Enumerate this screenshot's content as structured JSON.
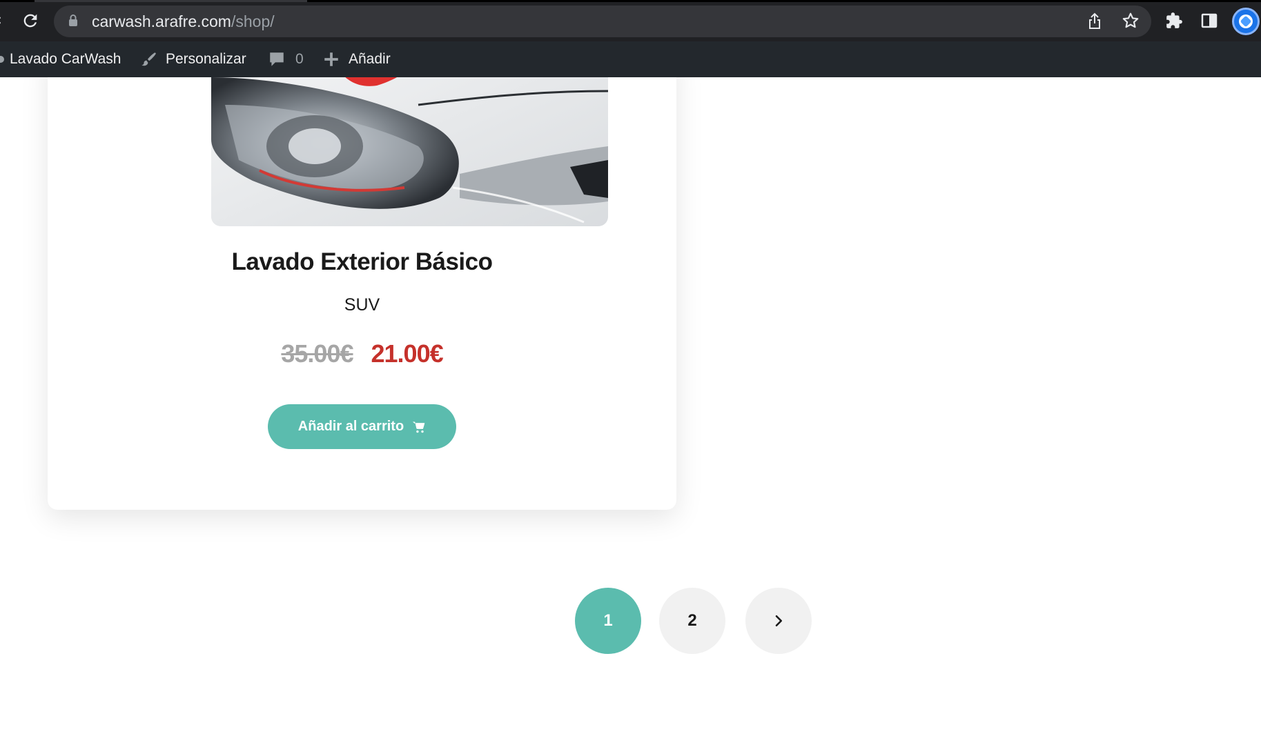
{
  "browser": {
    "url_host": "carwash.arafre.com",
    "url_path": "/shop/"
  },
  "adminbar": {
    "site_name": "Lavado CarWash",
    "customize_label": "Personalizar",
    "comments_count": "0",
    "new_label": "Añadir"
  },
  "product": {
    "title": "Lavado Exterior Básico",
    "variant": "SUV",
    "price_old": "35.00€",
    "price_new": "21.00€",
    "add_to_cart_label": "Añadir al carrito"
  },
  "pagination": {
    "pages": [
      "1",
      "2"
    ],
    "current": "1"
  },
  "colors": {
    "accent": "#5bbcae",
    "sale_price": "#c5312b",
    "old_price": "#a6a6a6"
  }
}
